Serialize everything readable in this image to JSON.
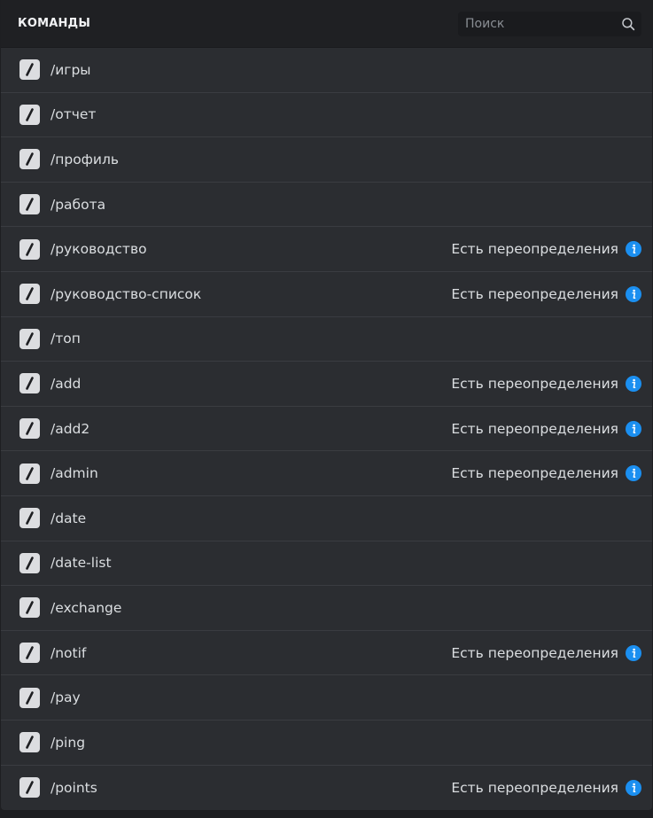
{
  "header": {
    "title": "КОМАНДЫ",
    "search_placeholder": "Поиск",
    "search_value": ""
  },
  "icons": {
    "command": "slash-icon",
    "info": "info-icon",
    "search": "search-icon"
  },
  "colors": {
    "info_accent": "#1b8ff0"
  },
  "commands": [
    {
      "name": "/игры",
      "override": ""
    },
    {
      "name": "/отчет",
      "override": ""
    },
    {
      "name": "/профиль",
      "override": ""
    },
    {
      "name": "/работа",
      "override": ""
    },
    {
      "name": "/руководство",
      "override": "Есть переопределения"
    },
    {
      "name": "/руководство-список",
      "override": "Есть переопределения"
    },
    {
      "name": "/топ",
      "override": ""
    },
    {
      "name": "/add",
      "override": "Есть переопределения"
    },
    {
      "name": "/add2",
      "override": "Есть переопределения"
    },
    {
      "name": "/admin",
      "override": "Есть переопределения"
    },
    {
      "name": "/date",
      "override": ""
    },
    {
      "name": "/date-list",
      "override": ""
    },
    {
      "name": "/exchange",
      "override": ""
    },
    {
      "name": "/notif",
      "override": "Есть переопределения"
    },
    {
      "name": "/pay",
      "override": ""
    },
    {
      "name": "/ping",
      "override": ""
    },
    {
      "name": "/points",
      "override": "Есть переопределения"
    }
  ]
}
